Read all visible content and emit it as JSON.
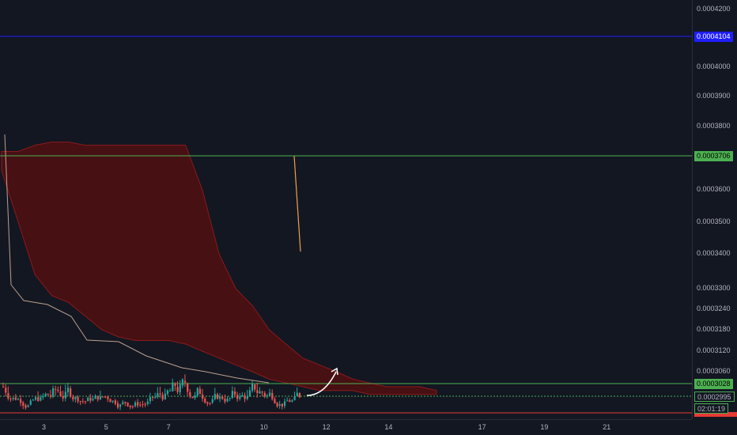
{
  "price_scale": {
    "ticks": [
      {
        "label": "0.0004200",
        "value": 0.00042
      },
      {
        "label": "0.0004000",
        "value": 0.0004
      },
      {
        "label": "0.0003900",
        "value": 0.00039
      },
      {
        "label": "0.0003800",
        "value": 0.00038
      },
      {
        "label": "0.0003600",
        "value": 0.00036
      },
      {
        "label": "0.0003500",
        "value": 0.00035
      },
      {
        "label": "0.0003400",
        "value": 0.00034
      },
      {
        "label": "0.0003300",
        "value": 0.00033
      },
      {
        "label": "0.0003240",
        "value": 0.000324
      },
      {
        "label": "0.0003180",
        "value": 0.000318
      },
      {
        "label": "0.0003120",
        "value": 0.000312
      },
      {
        "label": "0.0003060",
        "value": 0.000306
      }
    ]
  },
  "time_scale": {
    "ticks": [
      {
        "label": "3",
        "index": 3
      },
      {
        "label": "5",
        "index": 5
      },
      {
        "label": "7",
        "index": 7
      },
      {
        "label": "10",
        "index": 10
      },
      {
        "label": "12",
        "index": 12
      },
      {
        "label": "14",
        "index": 14
      },
      {
        "label": "17",
        "index": 17
      },
      {
        "label": "19",
        "index": 19
      },
      {
        "label": "21",
        "index": 21
      }
    ]
  },
  "horizontal_lines": [
    {
      "name": "blue-level-line",
      "value": 0.0004104,
      "label": "0.0004104",
      "color": "#1e1eff"
    },
    {
      "name": "upper-green-level-line",
      "value": 0.0003706,
      "label": "0.0003706",
      "color": "#4caf50"
    },
    {
      "name": "lower-green-level-line",
      "value": 0.0003028,
      "label": "0.0003028",
      "color": "#4caf50"
    },
    {
      "name": "red-level-line",
      "value": 0.00029,
      "label": "",
      "color": "#e53935"
    }
  ],
  "price_labels": {
    "current_price": "0.0002995",
    "countdown": "02:01:19"
  },
  "colors": {
    "background": "#131722",
    "cloud": "#5a0f0f",
    "up_candle": "#26a69a",
    "down_candle": "#ef5350",
    "blue_level": "#1e1eff",
    "green_level": "#4caf50",
    "red_level": "#e53935"
  },
  "chart_data": {
    "type": "line",
    "title": "",
    "x_tick_labels": [
      "3",
      "5",
      "7",
      "10",
      "12",
      "14",
      "17",
      "19",
      "21"
    ],
    "y_tick_labels": [
      "0.0004200",
      "0.0004000",
      "0.0003900",
      "0.0003800",
      "0.0003600",
      "0.0003500",
      "0.0003400",
      "0.0003300",
      "0.0003240",
      "0.0003180",
      "0.0003120",
      "0.0003060"
    ],
    "horizontal_levels": [
      0.0004104,
      0.0003706,
      0.0003028
    ],
    "current_price": 0.0002995,
    "grid": false,
    "series": [
      {
        "type": "ichimoku-cloud-upper",
        "values": [
          0.000372,
          0.000372,
          0.000374,
          0.000375,
          0.000375,
          0.000374,
          0.000374,
          0.000374,
          0.000374,
          0.000374,
          0.000374,
          0.000374,
          0.00036,
          0.00034,
          0.00033,
          0.000325,
          0.000318,
          0.000314,
          0.00031,
          0.000308,
          0.000306,
          0.000304,
          0.000303,
          0.000302,
          0.000302,
          0.000302,
          0.000301
        ]
      },
      {
        "type": "ichimoku-cloud-lower",
        "values": [
          0.000366,
          0.00035,
          0.000334,
          0.000328,
          0.000326,
          0.000322,
          0.000318,
          0.000316,
          0.000315,
          0.000315,
          0.000315,
          0.000314,
          0.000312,
          0.00031,
          0.000308,
          0.000306,
          0.000304,
          0.000303,
          0.000302,
          0.000301,
          0.000301,
          0.000301,
          0.0003,
          0.0003,
          0.0003,
          0.0003,
          0.0003
        ]
      }
    ]
  }
}
